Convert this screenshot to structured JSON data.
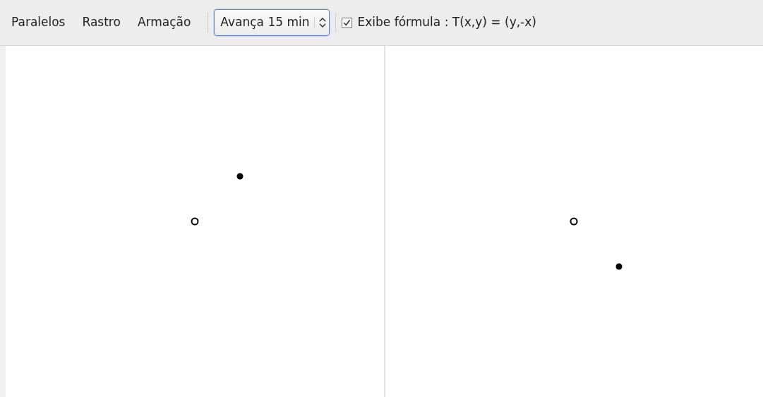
{
  "toolbar": {
    "buttons": [
      {
        "label": "Paralelos"
      },
      {
        "label": "Rastro"
      },
      {
        "label": "Armação"
      }
    ],
    "step_select": {
      "value": "Avança 15 min"
    },
    "formula_toggle": {
      "label": "Exibe fórmula : T(x,y) = (y,-x)",
      "checked": true
    }
  },
  "panels": [
    {
      "kind": "original"
    },
    {
      "kind": "transformed"
    }
  ]
}
